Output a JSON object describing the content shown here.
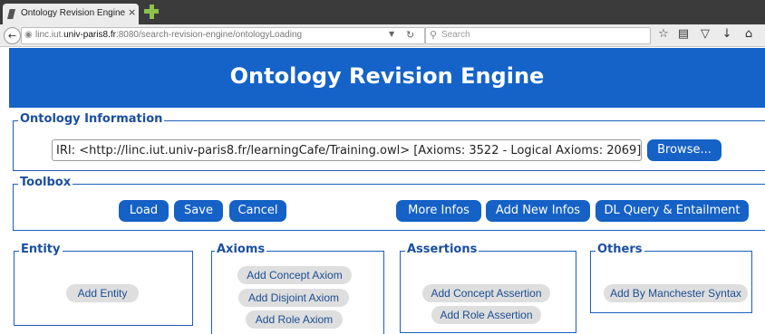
{
  "browser": {
    "tab_title": "Ontology Revision Engine",
    "tab_close": "×",
    "url_host_prefix": "linc.iut.",
    "url_host": "univ-paris8.fr",
    "url_path": ":8080/search-revision-engine/ontologyLoading",
    "search_placeholder": "Search",
    "icons": [
      "back-arrow-icon",
      "globe-icon",
      "dropdown-icon",
      "reload-icon",
      "search-icon",
      "star-icon",
      "reading-list-icon",
      "pocket-icon",
      "download-icon",
      "home-icon"
    ]
  },
  "header": {
    "title": "Ontology Revision Engine"
  },
  "ontology_info": {
    "legend": "Ontology Information",
    "iri_value": "IRI: <http://linc.iut.univ-paris8.fr/learningCafe/Training.owl> [Axioms: 3522 - Logical Axioms: 2069]",
    "browse_label": "Browse..."
  },
  "toolbox": {
    "legend": "Toolbox",
    "load": "Load",
    "save": "Save",
    "cancel": "Cancel",
    "more_infos": "More Infos",
    "add_new_infos": "Add New Infos",
    "dl_query": "DL Query & Entailment"
  },
  "entity": {
    "legend": "Entity",
    "add_entity": "Add Entity"
  },
  "axioms": {
    "legend": "Axioms",
    "add_concept_axiom": "Add Concept Axiom",
    "add_disjoint_axiom": "Add Disjoint Axiom",
    "add_role_axiom": "Add Role Axiom"
  },
  "assertions": {
    "legend": "Assertions",
    "add_concept_assertion": "Add Concept Assertion",
    "add_role_assertion": "Add Role Assertion"
  },
  "others": {
    "legend": "Others",
    "add_by_manchester": "Add By Manchester Syntax"
  },
  "colors": {
    "header_bg": "#1563c8",
    "button_bg": "#1561c6",
    "pill_bg": "#dedede",
    "legend_text": "#1a4fa0"
  }
}
